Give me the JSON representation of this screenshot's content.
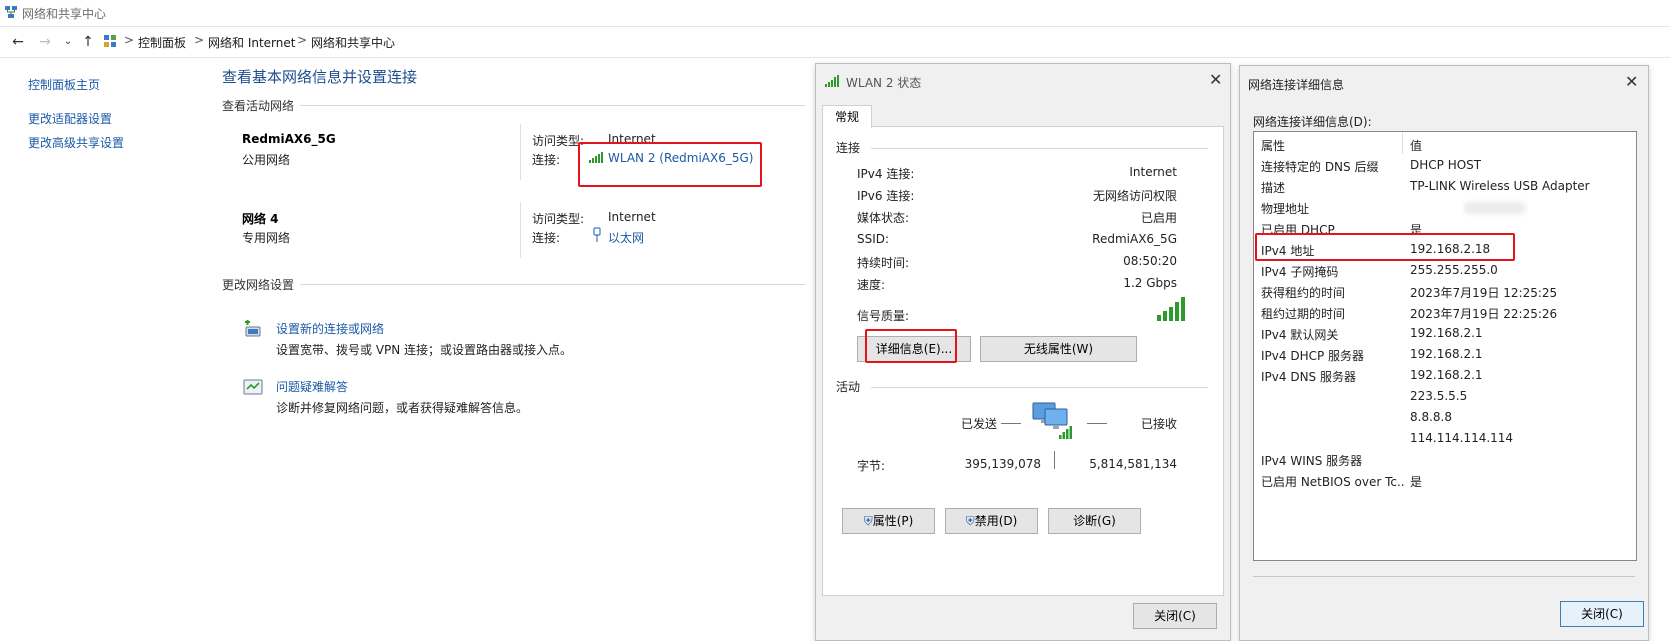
{
  "window": {
    "title": "网络和共享中心"
  },
  "nav": {
    "breadcrumbs": [
      "控制面板",
      "网络和 Internet",
      "网络和共享中心"
    ],
    "sep": ">"
  },
  "sidebar": {
    "items": [
      {
        "label": "控制面板主页"
      },
      {
        "label": "更改适配器设置"
      },
      {
        "label": "更改高级共享设置"
      }
    ]
  },
  "main": {
    "heading": "查看基本网络信息并设置连接",
    "active_section": "查看活动网络",
    "networks": [
      {
        "name": "RedmiAX6_5G",
        "category": "公用网络",
        "access_label": "访问类型:",
        "access_value": "Internet",
        "conn_label": "连接:",
        "conn_value": "WLAN 2 (RedmiAX6_5G)"
      },
      {
        "name": "网络 4",
        "category": "专用网络",
        "access_label": "访问类型:",
        "access_value": "Internet",
        "conn_label": "连接:",
        "conn_value": "以太网"
      }
    ],
    "change_section": "更改网络设置",
    "tasks": [
      {
        "title": "设置新的连接或网络",
        "desc": "设置宽带、拨号或 VPN 连接；或设置路由器或接入点。"
      },
      {
        "title": "问题疑难解答",
        "desc": "诊断并修复网络问题，或者获得疑难解答信息。"
      }
    ]
  },
  "wlan_dialog": {
    "title": "WLAN 2 状态",
    "tab": "常规",
    "connection_group": "连接",
    "rows": [
      {
        "label": "IPv4 连接:",
        "value": "Internet"
      },
      {
        "label": "IPv6 连接:",
        "value": "无网络访问权限"
      },
      {
        "label": "媒体状态:",
        "value": "已启用"
      },
      {
        "label": "SSID:",
        "value": "RedmiAX6_5G"
      },
      {
        "label": "持续时间:",
        "value": "08:50:20"
      },
      {
        "label": "速度:",
        "value": "1.2 Gbps"
      }
    ],
    "signal_label": "信号质量:",
    "signal_bars": 5,
    "details_button": "详细信息(E)...",
    "wireless_props_button": "无线属性(W)",
    "activity_group": "活动",
    "sent_label": "已发送",
    "received_label": "已接收",
    "bytes_label": "字节:",
    "bytes_sent": "395,139,078",
    "bytes_received": "5,814,581,134",
    "properties_button": "属性(P)",
    "disable_button": "禁用(D)",
    "diagnose_button": "诊断(G)",
    "close_button": "关闭(C)"
  },
  "details_dialog": {
    "title": "网络连接详细信息",
    "list_label": "网络连接详细信息(D):",
    "col_property": "属性",
    "col_value": "值",
    "rows": [
      {
        "prop": "连接特定的 DNS 后缀",
        "val": "DHCP HOST"
      },
      {
        "prop": "描述",
        "val": "TP-LINK Wireless USB Adapter"
      },
      {
        "prop": "物理地址",
        "val": ""
      },
      {
        "prop": "已启用 DHCP",
        "val": "是"
      },
      {
        "prop": "IPv4 地址",
        "val": "192.168.2.18"
      },
      {
        "prop": "IPv4 子网掩码",
        "val": "255.255.255.0"
      },
      {
        "prop": "获得租约的时间",
        "val": "2023年7月19日 12:25:25"
      },
      {
        "prop": "租约过期的时间",
        "val": "2023年7月19日 22:25:26"
      },
      {
        "prop": "IPv4 默认网关",
        "val": "192.168.2.1"
      },
      {
        "prop": "IPv4 DHCP 服务器",
        "val": "192.168.2.1"
      },
      {
        "prop": "IPv4 DNS 服务器",
        "val": "192.168.2.1"
      },
      {
        "prop": "",
        "val": "223.5.5.5"
      },
      {
        "prop": "",
        "val": "8.8.8.8"
      },
      {
        "prop": "",
        "val": "114.114.114.114"
      },
      {
        "prop": "IPv4 WINS 服务器",
        "val": ""
      },
      {
        "prop": "已启用 NetBIOS over Tc...",
        "val": "是"
      }
    ],
    "close_button": "关闭(C)"
  },
  "colors": {
    "link": "#1a5aa6",
    "highlight": "#e4141a",
    "signal": "#2e9a2e"
  }
}
